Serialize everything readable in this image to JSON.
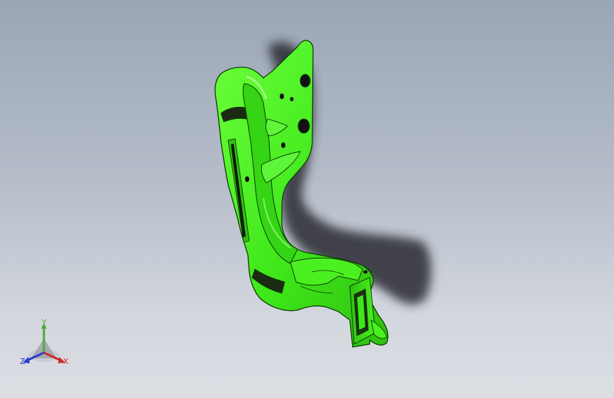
{
  "viewport": {
    "background_top": "#9aa5b6",
    "background_bottom": "#dcdfe4"
  },
  "model": {
    "body_color": "#3fe81a",
    "edge_color": "#0c3a06",
    "highlight_color": "#b8ff9a",
    "shadow_color": "#2a2c30"
  },
  "triad": {
    "x_label": "X",
    "y_label": "Y",
    "z_label": "Z",
    "x_color": "#d02a2a",
    "y_color": "#4caa3a",
    "z_color": "#2a3cc8"
  }
}
